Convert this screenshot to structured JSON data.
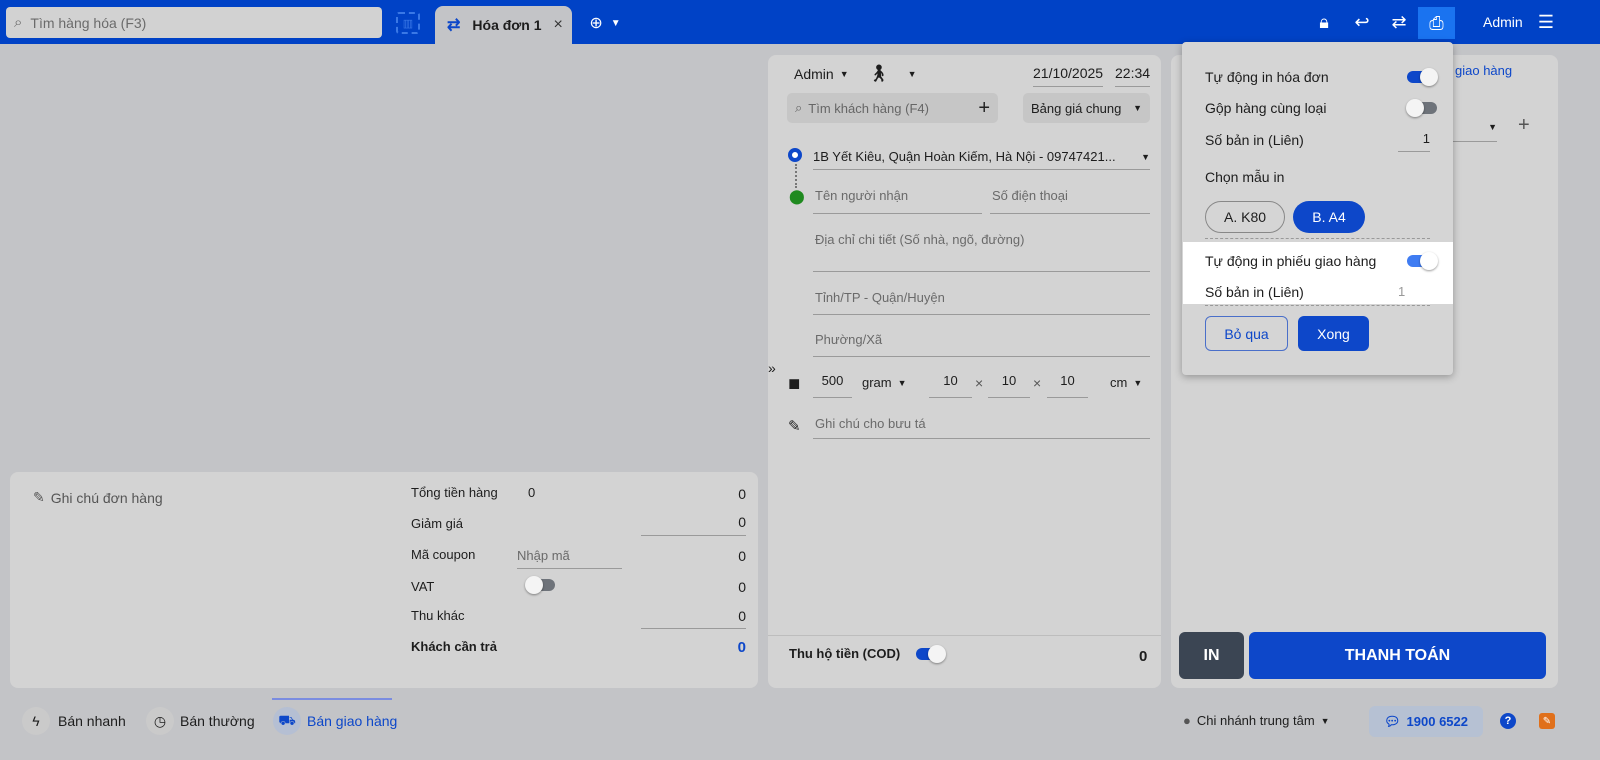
{
  "header": {
    "search_placeholder": "Tìm hàng hóa (F3)",
    "tab_label": "Hóa đơn 1",
    "user": "Admin"
  },
  "order": {
    "seller": "Admin",
    "date": "21/10/2025",
    "time": "22:34",
    "customer_search_placeholder": "Tìm khách hàng (F4)",
    "price_list": "Bảng giá chung",
    "from_address": "1B Yết Kiêu, Quận Hoàn Kiếm, Hà Nội - 09747421...",
    "recipient_name_placeholder": "Tên người nhận",
    "phone_placeholder": "Số điện thoại",
    "address_placeholder": "Địa chỉ chi tiết (Số nhà, ngõ, đường)",
    "province_placeholder": "Tỉnh/TP - Quận/Huyện",
    "ward_placeholder": "Phường/Xã",
    "weight": "500",
    "weight_unit": "gram",
    "length": "10",
    "width": "10",
    "height": "10",
    "dim_unit": "cm",
    "times": "×",
    "note_placeholder": "Ghi chú cho bưu tá",
    "cod_label": "Thu hộ tiền (COD)",
    "cod_value": "0"
  },
  "summary": {
    "note_label": "Ghi chú đơn hàng",
    "total_label": "Tổng tiền hàng",
    "total_count": "0",
    "total_value": "0",
    "discount_label": "Giảm giá",
    "discount_value": "0",
    "coupon_label": "Mã coupon",
    "coupon_placeholder": "Nhập mã",
    "coupon_value": "0",
    "vat_label": "VAT",
    "vat_value": "0",
    "other_label": "Thu khác",
    "other_value": "0",
    "pay_label": "Khách cần trả",
    "pay_value": "0"
  },
  "right": {
    "partial_label": "giao hàng",
    "print_button": "IN",
    "pay_button": "THANH TOÁN"
  },
  "popup": {
    "auto_print_invoice": "Tự động in hóa đơn",
    "merge_items": "Gộp hàng cùng loại",
    "copies_label": "Số bản in (Liên)",
    "copies_value": "1",
    "template_label": "Chọn mẫu in",
    "template_a": "A. K80",
    "template_b": "B. A4",
    "auto_print_delivery": "Tự động in phiếu giao hàng",
    "delivery_copies_label": "Số bản in (Liên)",
    "delivery_copies_value": "1",
    "cancel": "Bỏ qua",
    "done": "Xong"
  },
  "footer": {
    "quick_sale": "Bán nhanh",
    "normal_sale": "Bán thường",
    "delivery_sale": "Bán giao hàng",
    "branch": "Chi nhánh trung tâm",
    "hotline": "1900 6522"
  },
  "colors": {
    "brand": "#0042c6",
    "popup_bg": "#d5d5d5"
  }
}
